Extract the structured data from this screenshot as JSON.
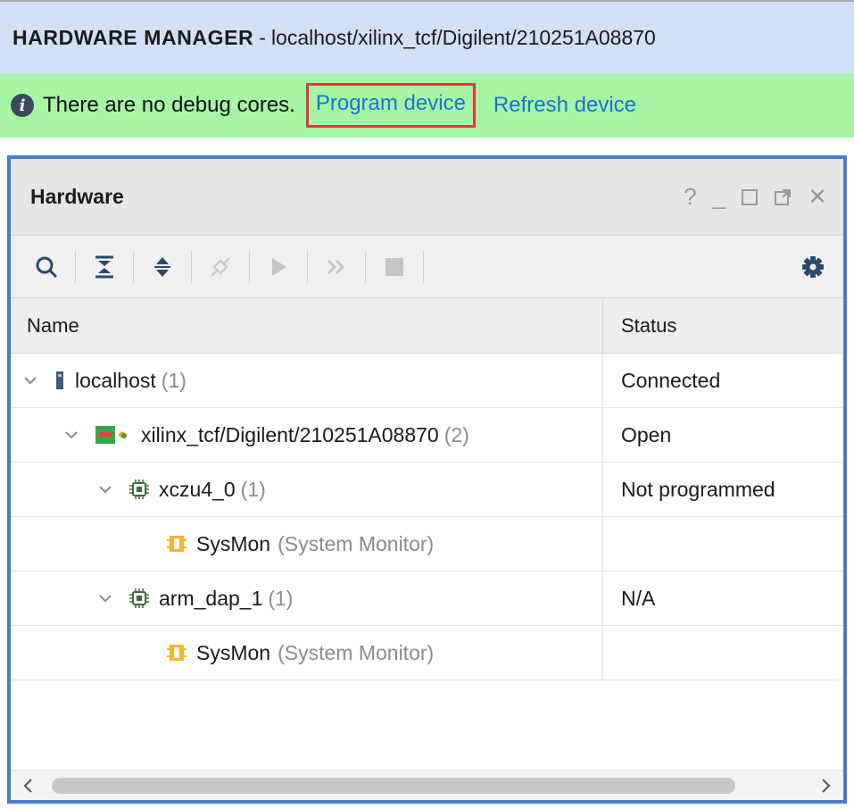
{
  "title_bar": {
    "name": "HARDWARE MANAGER",
    "separator": "-",
    "path": "localhost/xilinx_tcf/Digilent/210251A08870"
  },
  "banner": {
    "message": "There are no debug cores.",
    "program_link": "Program device",
    "refresh_link": "Refresh device"
  },
  "panel": {
    "title": "Hardware",
    "controls": {
      "help": "?",
      "minimize": "_",
      "close": "✕"
    }
  },
  "toolbar": {
    "icons": [
      "search-icon",
      "collapse-all-icon",
      "expand-all-icon",
      "auto-connect-icon",
      "run-trigger-icon",
      "run-trigger-immediate-icon",
      "stop-trigger-icon",
      "gear-icon"
    ]
  },
  "table": {
    "columns": {
      "name": "Name",
      "status": "Status"
    },
    "rows": [
      {
        "label": "localhost",
        "count": "(1)",
        "detail": "",
        "status": "Connected",
        "level": 0,
        "expandable": true,
        "icon": "server-icon"
      },
      {
        "label": "xilinx_tcf/Digilent/210251A08870",
        "count": "(2)",
        "detail": "",
        "status": "Open",
        "level": 1,
        "expandable": true,
        "icon": "jtag-cable-icon"
      },
      {
        "label": "xczu4_0",
        "count": "(1)",
        "detail": "",
        "status": "Not programmed",
        "level": 2,
        "expandable": true,
        "icon": "chip-icon"
      },
      {
        "label": "SysMon",
        "count": "",
        "detail": "(System Monitor)",
        "status": "",
        "level": 3,
        "expandable": false,
        "icon": "sysmon-icon"
      },
      {
        "label": "arm_dap_1",
        "count": "(1)",
        "detail": "",
        "status": "N/A",
        "level": 2,
        "expandable": true,
        "icon": "chip-icon"
      },
      {
        "label": "SysMon",
        "count": "",
        "detail": "(System Monitor)",
        "status": "",
        "level": 3,
        "expandable": false,
        "icon": "sysmon-icon"
      }
    ]
  },
  "colors": {
    "title_bar_bg": "#d2e0f7",
    "banner_bg": "#a5f5a5",
    "link": "#1a73c8",
    "highlight_border": "#e8343a",
    "panel_border": "#4a7bc8"
  }
}
